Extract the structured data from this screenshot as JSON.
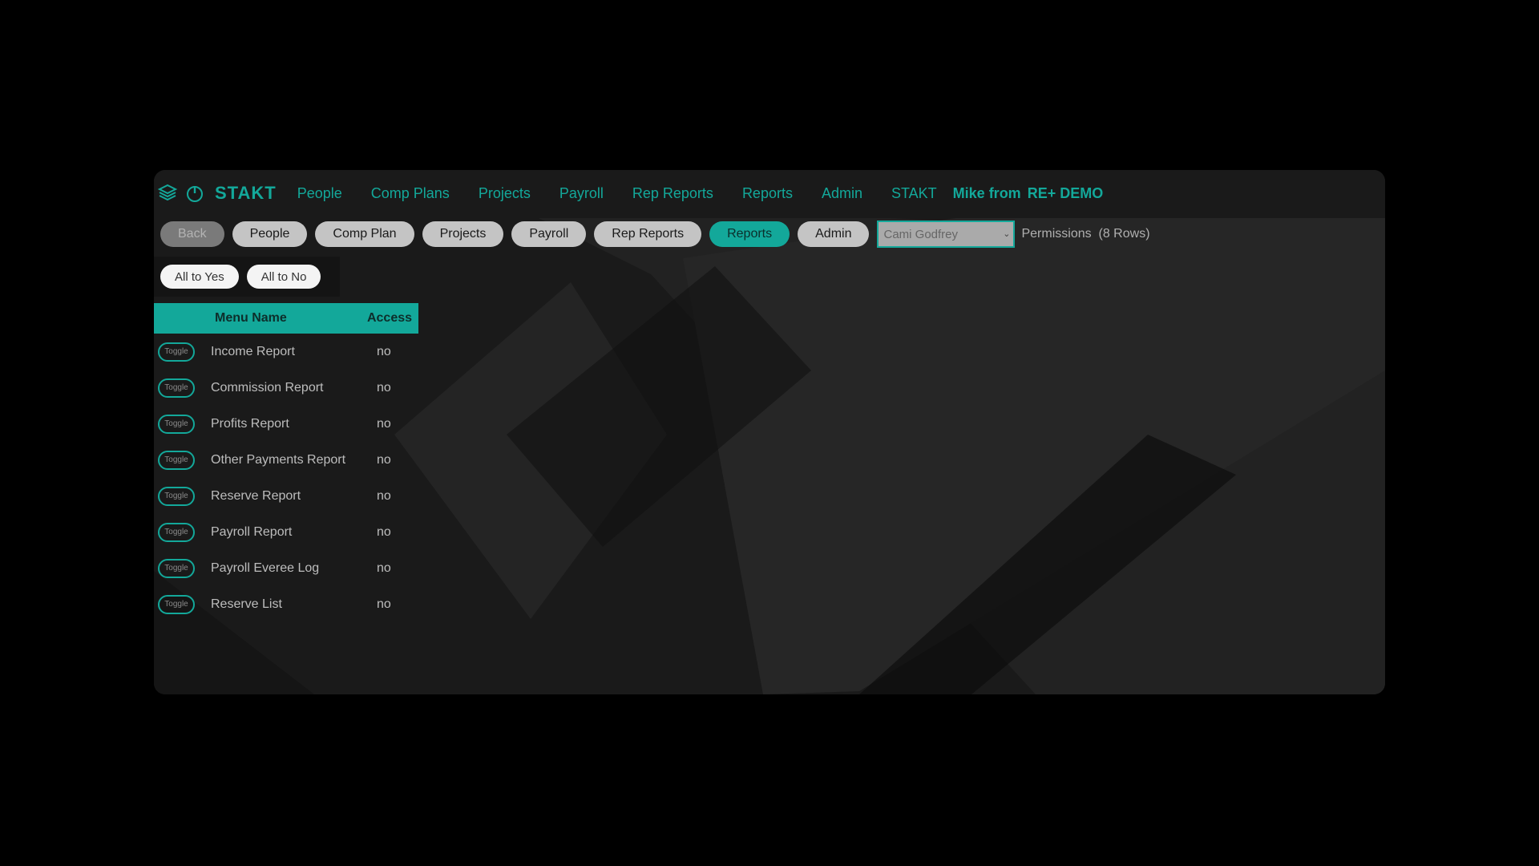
{
  "nav": {
    "brand": "STAKT",
    "links": [
      "People",
      "Comp Plans",
      "Projects",
      "Payroll",
      "Rep Reports",
      "Reports",
      "Admin",
      "STAKT"
    ],
    "user_prefix": "Mike from",
    "user_org": "RE+ DEMO"
  },
  "buttons": {
    "back": "Back",
    "items": [
      "People",
      "Comp Plan",
      "Projects",
      "Payroll",
      "Rep Reports",
      "Reports",
      "Admin"
    ],
    "active": "Reports"
  },
  "user_select": {
    "value": "Cami Godfrey"
  },
  "permissions_label": "Permissions  (8 Rows)",
  "bulk": {
    "yes": "All to Yes",
    "no": "All to No"
  },
  "table": {
    "headers": {
      "name": "Menu Name",
      "access": "Access"
    },
    "toggle_label": "Toggle",
    "rows": [
      {
        "name": "Income Report",
        "access": "no"
      },
      {
        "name": "Commission Report",
        "access": "no"
      },
      {
        "name": "Profits Report",
        "access": "no"
      },
      {
        "name": "Other Payments Report",
        "access": "no"
      },
      {
        "name": "Reserve Report",
        "access": "no"
      },
      {
        "name": "Payroll Report",
        "access": "no"
      },
      {
        "name": "Payroll Everee Log",
        "access": "no"
      },
      {
        "name": "Reserve List",
        "access": "no"
      }
    ]
  },
  "colors": {
    "accent": "#13a89a",
    "page_bg": "#000000",
    "panel_bg": "#1b1b1b"
  }
}
